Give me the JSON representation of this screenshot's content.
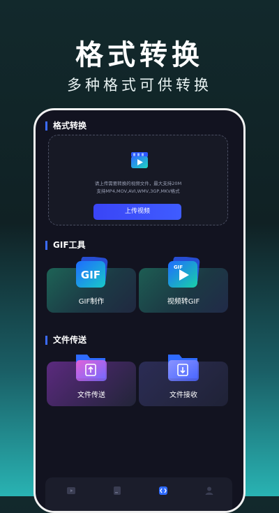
{
  "hero": {
    "title": "格式转换",
    "subtitle": "多种格式可供转换"
  },
  "format_section": {
    "title": "格式转换",
    "hint_line1": "请上传需要转换的视频文件，最大支持20M",
    "hint_line2": "支持MP4,MOV,AVI,WMV,3GP,MKV格式",
    "upload_button": "上传视频",
    "icon": "video-clip-icon"
  },
  "gif_section": {
    "title": "GIF工具",
    "cards": [
      {
        "label": "GIF制作",
        "icon": "gif-folder-icon",
        "icon_text": "GIF"
      },
      {
        "label": "视频转GIF",
        "icon": "video-to-gif-folder-icon",
        "icon_text": "GIF"
      }
    ]
  },
  "file_section": {
    "title": "文件传送",
    "cards": [
      {
        "label": "文件传送",
        "icon": "file-send-folder-icon"
      },
      {
        "label": "文件接收",
        "icon": "file-receive-folder-icon"
      }
    ]
  },
  "bottom_nav": {
    "items": [
      {
        "icon": "play-icon",
        "active": false
      },
      {
        "icon": "document-icon",
        "active": false
      },
      {
        "icon": "convert-icon",
        "active": true
      },
      {
        "icon": "profile-icon",
        "active": false
      }
    ]
  },
  "colors": {
    "accent": "#3b6bff",
    "phone_bg": "#121320",
    "frame": "#f2f2f2"
  }
}
